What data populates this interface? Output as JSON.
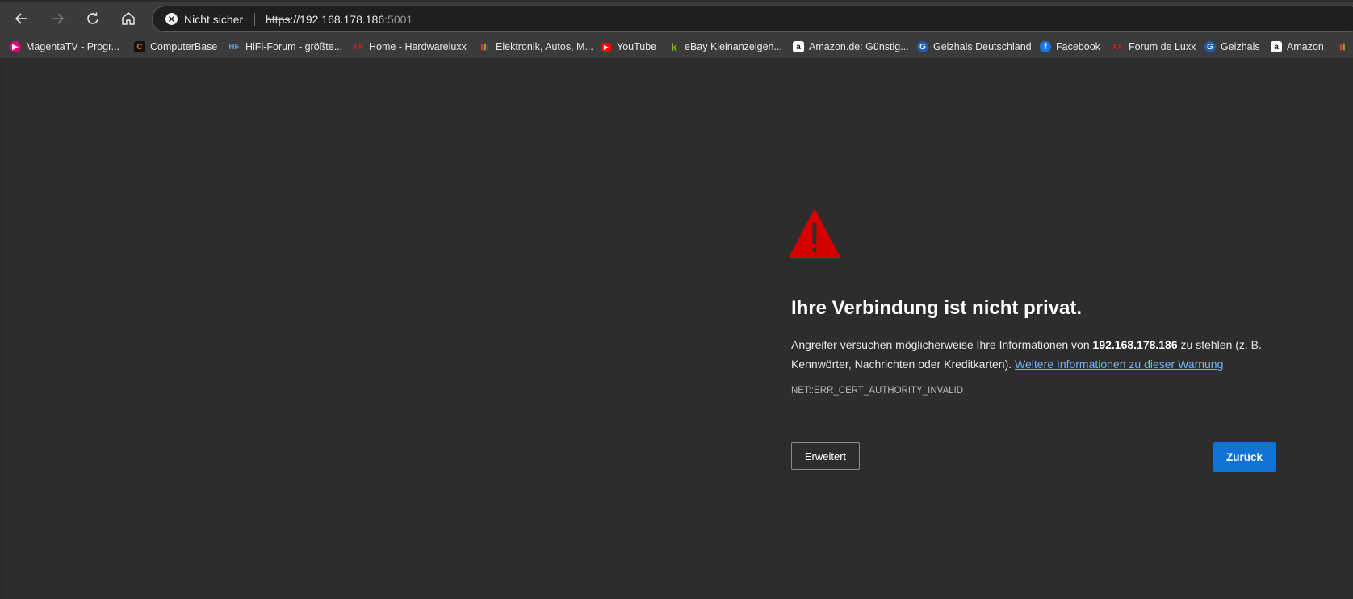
{
  "toolbar": {
    "security_label": "Nicht sicher",
    "url_scheme": "https",
    "url_host": "://192.168.178.186",
    "url_port": ":5001"
  },
  "bookmarks": [
    {
      "label": "MagentaTV - Progr...",
      "icon": "magenta-tv-icon",
      "color": "#e20074"
    },
    {
      "label": "ComputerBase",
      "icon": "computerbase-icon",
      "color": "#ff6a00"
    },
    {
      "label": "HiFi-Forum - größte...",
      "icon": "hifi-forum-icon",
      "color": "#6d9ccf"
    },
    {
      "label": "Home - Hardwareluxx",
      "icon": "hardwareluxx-icon",
      "color": "#cc1f1f"
    },
    {
      "label": "Elektronik, Autos, M...",
      "icon": "ebay-icon",
      "color": "#e53238"
    },
    {
      "label": "YouTube",
      "icon": "youtube-icon",
      "color": "#ff0000"
    },
    {
      "label": "eBay Kleinanzeigen...",
      "icon": "kleinanzeigen-icon",
      "color": "#86b817"
    },
    {
      "label": "Amazon.de: Günstig...",
      "icon": "amazon-icon",
      "color": "#ffffff"
    },
    {
      "label": "Geizhals Deutschland",
      "icon": "geizhals-icon",
      "color": "#1a5fb4"
    },
    {
      "label": "Facebook",
      "icon": "facebook-icon",
      "color": "#1877f2"
    },
    {
      "label": "Forum de Luxx",
      "icon": "hardwareluxx-forum-icon",
      "color": "#cc1f1f"
    },
    {
      "label": "Geizhals",
      "icon": "geizhals-icon",
      "color": "#1a5fb4"
    },
    {
      "label": "Amazon",
      "icon": "amazon-icon",
      "color": "#ffffff"
    }
  ],
  "error_page": {
    "title": "Ihre Verbindung ist nicht privat.",
    "desc_before": "Angreifer versuchen möglicherweise Ihre Informationen von ",
    "desc_host": "192.168.178.186",
    "desc_after": " zu stehlen (z. B. Kennwörter, Nachrichten oder Kreditkarten). ",
    "more_info_link": "Weitere Informationen zu dieser Warnung",
    "error_code": "NET::ERR_CERT_AUTHORITY_INVALID",
    "advanced_label": "Erweitert",
    "back_label": "Zurück",
    "warning_color": "#d40000",
    "primary_color": "#0e73d2"
  }
}
